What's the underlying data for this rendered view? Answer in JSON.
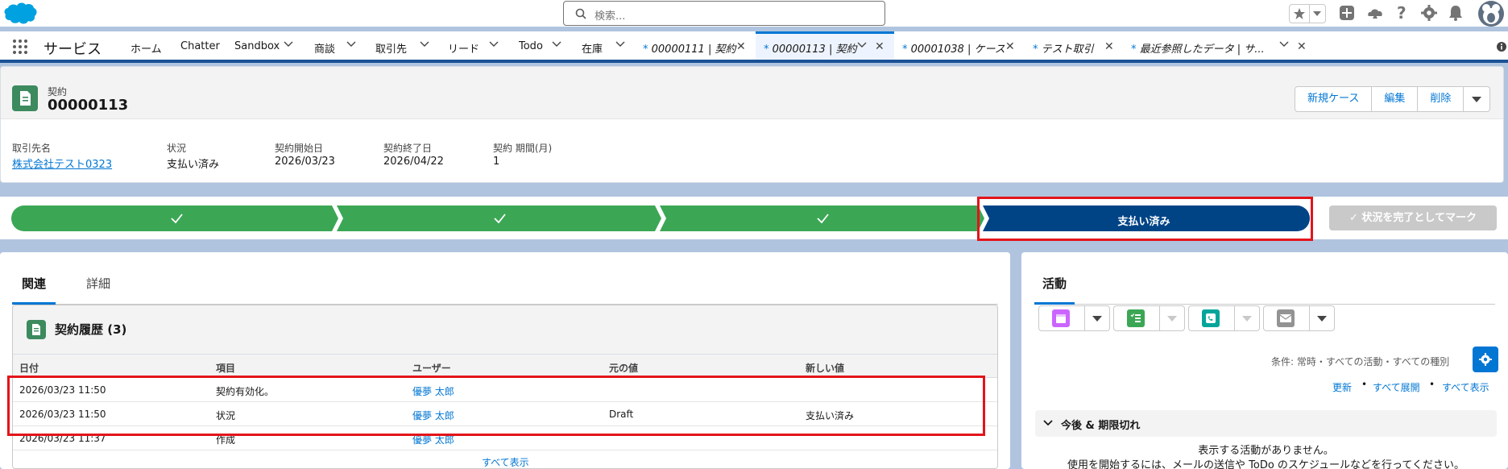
{
  "header": {
    "search_placeholder": "検索...",
    "app_name": "サービス"
  },
  "nav": {
    "items": [
      {
        "label": "ホーム"
      },
      {
        "label": "Chatter"
      },
      {
        "label": "Sandbox"
      },
      {
        "label": "商談"
      },
      {
        "label": "取引先"
      },
      {
        "label": "リード"
      },
      {
        "label": "Todo"
      },
      {
        "label": "在庫"
      }
    ],
    "tabs": [
      {
        "label": "00000111 | 契約",
        "dirty_mark": "*"
      },
      {
        "label": "00000113 | 契約",
        "dirty_mark": "*",
        "active": true
      },
      {
        "label": "00001038 | ケース",
        "dirty_mark": "*"
      },
      {
        "label": "テスト取引",
        "dirty_mark": "*"
      },
      {
        "label": "最近参照したデータ | サ...",
        "dirty_mark": "*"
      }
    ]
  },
  "record": {
    "object_label": "契約",
    "title": "00000113",
    "buttons": {
      "new_case": "新規ケース",
      "edit": "編集",
      "delete": "削除"
    },
    "fields": [
      {
        "label": "取引先名",
        "value": "株式会社テスト0323",
        "link": true
      },
      {
        "label": "状況",
        "value": "支払い済み"
      },
      {
        "label": "契約開始日",
        "value": "2026/03/23"
      },
      {
        "label": "契約終了日",
        "value": "2026/04/22"
      },
      {
        "label": "契約 期間(月)",
        "value": "1"
      }
    ]
  },
  "path": {
    "completed_steps": 3,
    "current_step": "支払い済み",
    "complete_button": "状況を完了としてマーク",
    "step_color": "#3ba755",
    "current_color": "#014486"
  },
  "related": {
    "tabs": [
      "関連",
      "詳細"
    ],
    "card_title": "契約履歴 (3)",
    "columns": [
      "日付",
      "項目",
      "ユーザー",
      "元の値",
      "新しい値"
    ],
    "rows": [
      {
        "date": "2026/03/23 11:50",
        "field": "契約有効化。",
        "user": "優夢 太郎",
        "old": "",
        "new": ""
      },
      {
        "date": "2026/03/23 11:50",
        "field": "状況",
        "user": "優夢 太郎",
        "old": "Draft",
        "new": "支払い済み"
      },
      {
        "date": "2026/03/23 11:37",
        "field": "作成",
        "user": "優夢 太郎",
        "old": "",
        "new": ""
      }
    ],
    "view_all": "すべて表示"
  },
  "activity": {
    "tab": "活動",
    "filter": "条件: 常時・すべての活動・すべての種別",
    "links": {
      "refresh": "更新",
      "expand_all": "すべて展開",
      "show_all": "すべて表示"
    },
    "upcoming_label": "今後 & 期限切れ",
    "empty_1": "表示する活動がありません。",
    "empty_2": "使用を開始するには、メールの送信や ToDo のスケジュールなどを行ってください。"
  }
}
